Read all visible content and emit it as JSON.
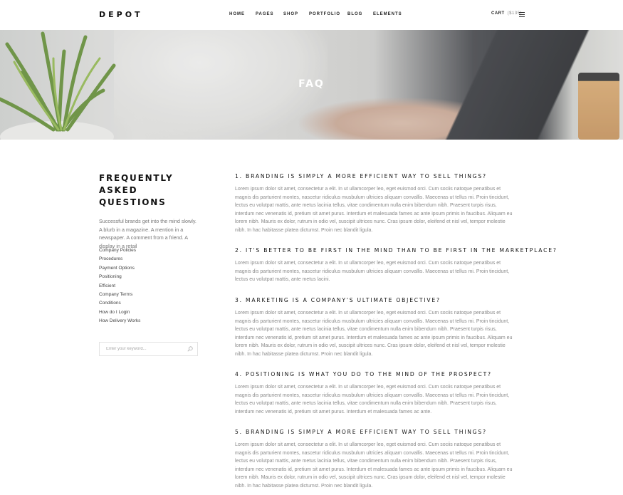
{
  "header": {
    "logo": "DEPOT",
    "nav": [
      "HOME",
      "PAGES",
      "SHOP",
      "PORTFOLIO",
      "BLOG",
      "ELEMENTS"
    ],
    "cart_label": "CART",
    "cart_price": "($135)",
    "menu_icon": "hamburger-menu-icon"
  },
  "hero": {
    "title": "FAQ"
  },
  "sidebar": {
    "title": "FREQUENTLY ASKED QUESTIONS",
    "description": "Successful brands get into the mind slowly. A blurb in a magazine. A mention in a newspaper. A comment from a friend. A display in a retail",
    "links": [
      "Company Policies",
      "Procedures",
      "Payment Options",
      "Positioning",
      "Efficient",
      "Company Terms",
      "Conditions",
      "How do I Login",
      "How Delivery Works"
    ],
    "search": {
      "placeholder": "Enter your keyword...",
      "icon": "search-icon"
    }
  },
  "faq": [
    {
      "question": "1. BRANDING IS SIMPLY A MORE EFFICIENT WAY TO SELL THINGS?",
      "answer": "Lorem ipsum dolor sit amet, consectetur a elit. In ut ullamcorper leo, eget euismod orci. Cum sociis natoque penatibus et magnis dis parturient montes, nascetur ridiculus musbulum ultricies aliquam convallis. Maecenas ut tellus mi. Proin tincidunt, lectus eu volutpat mattis, ante metus lacinia tellus, vitae condimentum nulla enim bibendum nibh. Praesent turpis risus, interdum nec venenatis id, pretium sit amet purus. Interdum et malesuada fames ac ante ipsum primis in faucibus. Aliquam eu lorem nibh. Mauris ex dolor, rutrum in odio vel, suscipit ultrices nunc. Cras ipsum dolor, eleifend et nisl vel, tempor molestie nibh. In hac habitasse platea dictumst. Proin nec blandit ligula."
    },
    {
      "question": "2. IT'S BETTER TO BE FIRST IN THE MIND THAN TO BE FIRST IN THE MARKETPLACE?",
      "answer": "Lorem ipsum dolor sit amet, consectetur a elit. In ut ullamcorper leo, eget euismod orci. Cum sociis natoque penatibus et magnis dis parturient montes, nascetur ridiculus musbulum ultricies aliquam convallis. Maecenas ut tellus mi. Proin tincidunt, lectus eu volutpat mattis, ante metus lacini."
    },
    {
      "question": "3. MARKETING IS A COMPANY'S ULTIMATE OBJECTIVE?",
      "answer": "Lorem ipsum dolor sit amet, consectetur a elit. In ut ullamcorper leo, eget euismod orci. Cum sociis natoque penatibus et magnis dis parturient montes, nascetur ridiculus musbulum ultricies aliquam convallis. Maecenas ut tellus mi. Proin tincidunt, lectus eu volutpat mattis, ante metus lacinia tellus, vitae condimentum nulla enim bibendum nibh. Praesent turpis risus, interdum nec venenatis id, pretium sit amet purus. Interdum et malesuada fames ac ante ipsum primis in faucibus. Aliquam eu lorem nibh. Mauris ex dolor, rutrum in odio vel, suscipit ultrices nunc. Cras ipsum dolor, eleifend et nisl vel, tempor molestie nibh. In hac habitasse platea dictumst. Proin nec blandit ligula."
    },
    {
      "question": "4. POSITIONING IS WHAT YOU DO TO THE MIND OF THE PROSPECT?",
      "answer": "Lorem ipsum dolor sit amet, consectetur a elit. In ut ullamcorper leo, eget euismod orci. Cum sociis natoque penatibus et magnis dis parturient montes, nascetur ridiculus musbulum ultricies aliquam convallis. Maecenas ut tellus mi. Proin tincidunt, lectus eu volutpat mattis, ante metus lacinia tellus, vitae condimentum nulla enim bibendum nibh. Praesent turpis risus, interdum nec venenatis id, pretium sit amet purus. Interdum et malesuada fames ac ante."
    },
    {
      "question": "5. BRANDING IS SIMPLY A MORE EFFICIENT WAY TO SELL THINGS?",
      "answer": "Lorem ipsum dolor sit amet, consectetur a elit. In ut ullamcorper leo, eget euismod orci. Cum sociis natoque penatibus et magnis dis parturient montes, nascetur ridiculus musbulum ultricies aliquam convallis. Maecenas ut tellus mi. Proin tincidunt, lectus eu volutpat mattis, ante metus lacinia tellus, vitae condimentum nulla enim bibendum nibh. Praesent turpis risus, interdum nec venenatis id, pretium sit amet purus. Interdum et malesuada fames ac ante ipsum primis in faucibus. Aliquam eu lorem nibh. Mauris ex dolor, rutrum in odio vel, suscipit ultrices nunc. Cras ipsum dolor, eleifend et nisl vel, tempor molestie nibh. In hac habitasse platea dictumst. Proin nec blandit ligula."
    }
  ]
}
